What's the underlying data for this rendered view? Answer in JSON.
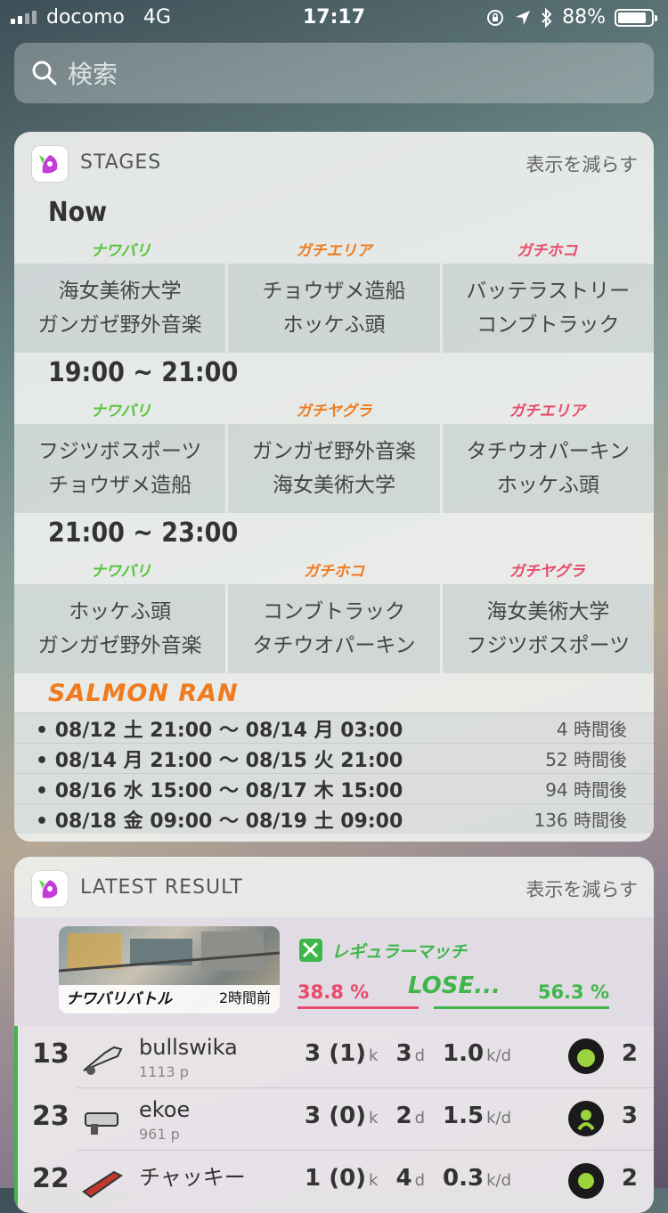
{
  "status": {
    "carrier": "docomo",
    "network": "4G",
    "time": "17:17",
    "battery": "88%",
    "battery_level": 0.88
  },
  "search": {
    "placeholder": "検索"
  },
  "stages_widget": {
    "title": "STAGES",
    "action": "表示を減らす",
    "schedules": [
      {
        "period": "Now",
        "modes": [
          {
            "name": "ナワバリ",
            "color": "#56c43b"
          },
          {
            "name": "ガチエリア",
            "color": "#f07a1e"
          },
          {
            "name": "ガチホコ",
            "color": "#e94a6b"
          }
        ],
        "stages": [
          [
            "海女美術大学",
            "ガンガゼ野外音楽"
          ],
          [
            "チョウザメ造船",
            "ホッケふ頭"
          ],
          [
            "バッテラストリー",
            "コンブトラック"
          ]
        ]
      },
      {
        "period": "19:00 ~ 21:00",
        "modes": [
          {
            "name": "ナワバリ",
            "color": "#56c43b"
          },
          {
            "name": "ガチヤグラ",
            "color": "#f07a1e"
          },
          {
            "name": "ガチエリア",
            "color": "#e94a6b"
          }
        ],
        "stages": [
          [
            "フジツボスポーツ",
            "チョウザメ造船"
          ],
          [
            "ガンガゼ野外音楽",
            "海女美術大学"
          ],
          [
            "タチウオパーキン",
            "ホッケふ頭"
          ]
        ]
      },
      {
        "period": "21:00 ~ 23:00",
        "modes": [
          {
            "name": "ナワバリ",
            "color": "#56c43b"
          },
          {
            "name": "ガチホコ",
            "color": "#f07a1e"
          },
          {
            "name": "ガチヤグラ",
            "color": "#e94a6b"
          }
        ],
        "stages": [
          [
            "ホッケふ頭",
            "ガンガゼ野外音楽"
          ],
          [
            "コンブトラック",
            "タチウオパーキン"
          ],
          [
            "海女美術大学",
            "フジツボスポーツ"
          ]
        ]
      }
    ],
    "salmon": {
      "title": "SALMON RAN",
      "rows": [
        {
          "range": "• 08/12 土  21:00 〜 08/14 月  03:00",
          "ago": "4 時間後"
        },
        {
          "range": "• 08/14 月  21:00 〜 08/15 火  21:00",
          "ago": "52 時間後"
        },
        {
          "range": "• 08/16 水  15:00 〜 08/17 木  15:00",
          "ago": "94 時間後"
        },
        {
          "range": "• 08/18 金  09:00 〜 08/19 土  09:00",
          "ago": "136 時間後"
        }
      ]
    }
  },
  "result_widget": {
    "title": "LATEST RESULT",
    "action": "表示を減らす",
    "battle": {
      "mode": "ナワバリバトル",
      "ago": "2時間前",
      "match": "レギュラーマッチ",
      "result": "LOSE...",
      "our_pct": "38.8 %",
      "their_pct": "56.3 %",
      "our_ratio": 38.8,
      "their_ratio": 56.3
    },
    "players": [
      {
        "rank": "13",
        "name": "bullswika",
        "points": "1113 p",
        "kills": "3 (1)",
        "k": "k",
        "deaths": "3",
        "d": "d",
        "kd": "1.0",
        "kd_unit": "k/d",
        "specials": "2"
      },
      {
        "rank": "23",
        "name": "ekoe",
        "points": "961 p",
        "kills": "3 (0)",
        "k": "k",
        "deaths": "2",
        "d": "d",
        "kd": "1.5",
        "kd_unit": "k/d",
        "specials": "3"
      },
      {
        "rank": "22",
        "name": "チャッキー",
        "points": "",
        "kills": "1 (0)",
        "k": "k",
        "deaths": "4",
        "d": "d",
        "kd": "0.3",
        "kd_unit": "k/d",
        "specials": "2"
      }
    ]
  }
}
